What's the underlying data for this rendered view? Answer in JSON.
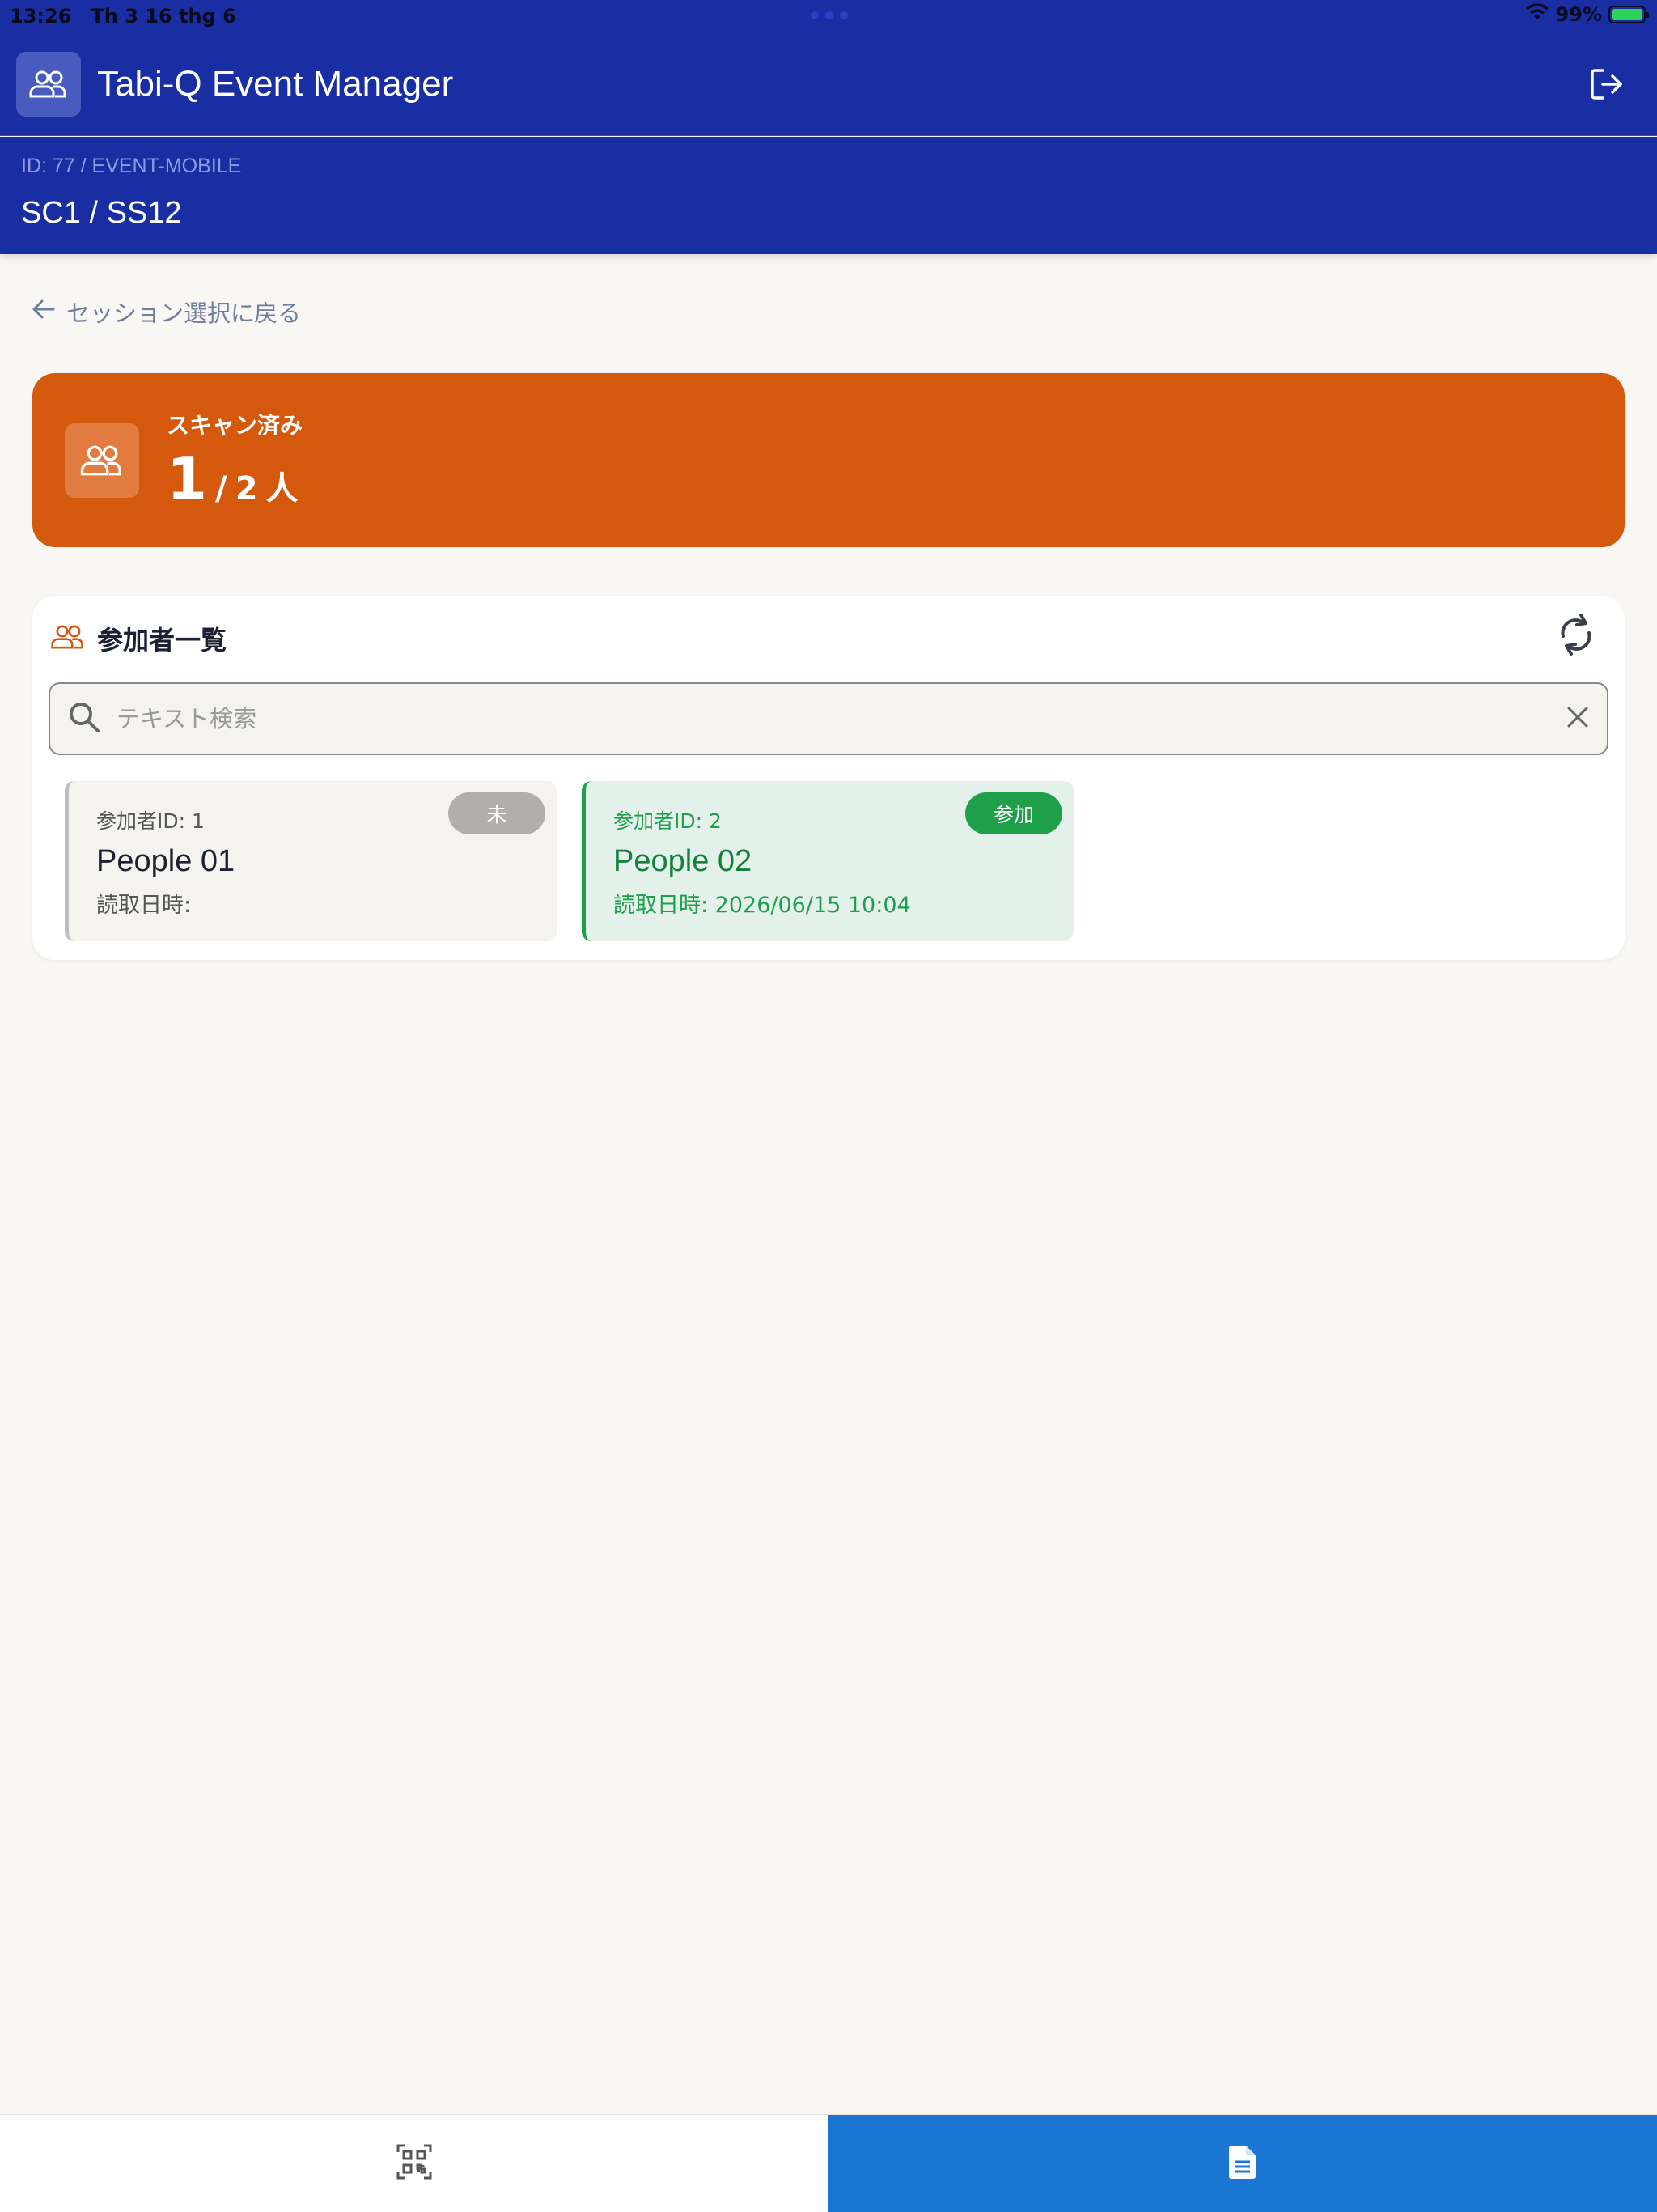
{
  "status_bar": {
    "time": "13:26",
    "date": "Th 3 16 thg 6",
    "battery": "99%"
  },
  "app": {
    "title": "Tabi-Q Event Manager"
  },
  "event": {
    "id_line": "ID: 77 / EVENT-MOBILE",
    "session": "SC1 / SS12"
  },
  "nav": {
    "back_label": "セッション選択に戻る"
  },
  "scan_summary": {
    "label": "スキャン済み",
    "scanned": "1",
    "separator": "/",
    "total": "2",
    "unit": "人"
  },
  "participants": {
    "title": "参加者一覧",
    "search_placeholder": "テキスト検索",
    "items": [
      {
        "id_label": "参加者ID: 1",
        "name": "People 01",
        "read_time": "読取日時:",
        "status": "未"
      },
      {
        "id_label": "参加者ID: 2",
        "name": "People 02",
        "read_time": "読取日時: 2026/06/15 10:04",
        "status": "参加"
      }
    ]
  },
  "colors": {
    "header": "#1a2ea3",
    "accent_orange": "#d4590d",
    "attended_green": "#1ea04b",
    "active_tab": "#1a76d2"
  },
  "icons": {
    "app_logo": "users-icon",
    "logout": "logout-icon",
    "back": "arrow-left-icon",
    "summary": "users-icon",
    "list": "users-icon",
    "refresh": "refresh-icon",
    "search": "search-icon",
    "clear": "close-icon",
    "tab_scan": "qr-code-icon",
    "tab_list": "document-icon"
  }
}
